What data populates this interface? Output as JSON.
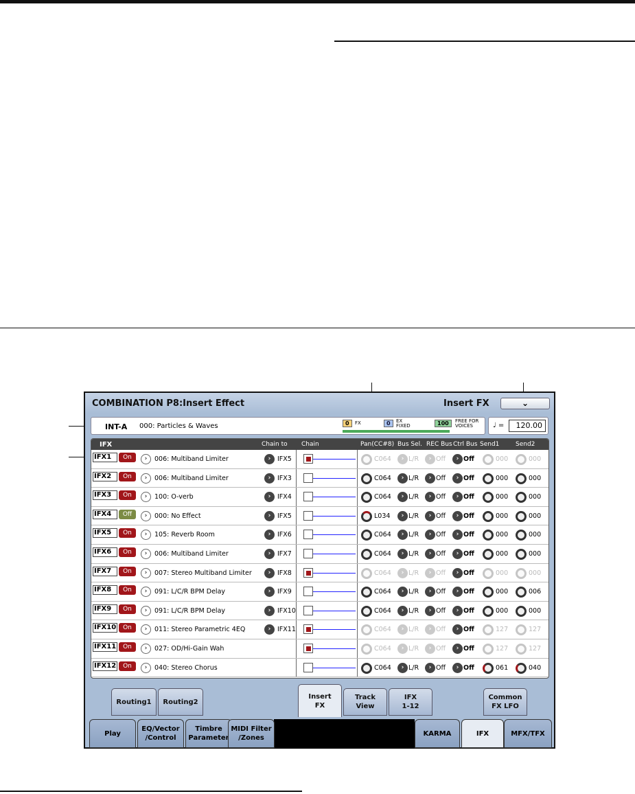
{
  "header": {
    "title": "COMBINATION P8:Insert Effect",
    "page": "Insert FX",
    "menu_icon": "chevron-down-icon"
  },
  "info": {
    "bank": "INT-A",
    "program": "000: Particles & Waves",
    "fx": "0",
    "fx_label": "FX",
    "ex": "0",
    "ex_label1": "EX",
    "ex_label2": "FIXED",
    "free": "100",
    "free_label1": "FREE FOR",
    "free_label2": "VOICES",
    "tempo_symbol": "♩ =",
    "tempo": "120.00"
  },
  "columns": {
    "ifx": "IFX",
    "chain_to": "Chain to",
    "chain": "Chain",
    "pan": "Pan(CC#8)",
    "bus": "Bus Sel.",
    "rec": "REC Bus",
    "ctrl": "Ctrl Bus",
    "send1": "Send1",
    "send2": "Send2"
  },
  "rows": [
    {
      "ifx": "IFX1",
      "state": "On",
      "fx": "006: Multiband Limiter",
      "chain_to": "IFX5",
      "chain": true,
      "pan": "C064",
      "bus": "L/R",
      "rec": "Off",
      "ctrl": "Off",
      "send1": "000",
      "send2": "000",
      "dim": true
    },
    {
      "ifx": "IFX2",
      "state": "On",
      "fx": "006: Multiband Limiter",
      "chain_to": "IFX3",
      "chain": false,
      "pan": "C064",
      "bus": "L/R",
      "rec": "Off",
      "ctrl": "Off",
      "send1": "000",
      "send2": "000",
      "dim": false
    },
    {
      "ifx": "IFX3",
      "state": "On",
      "fx": "100: O-verb",
      "chain_to": "IFX4",
      "chain": false,
      "pan": "C064",
      "bus": "L/R",
      "rec": "Off",
      "ctrl": "Off",
      "send1": "000",
      "send2": "000",
      "dim": false
    },
    {
      "ifx": "IFX4",
      "state": "Off",
      "fx": "000: No Effect",
      "chain_to": "IFX5",
      "chain": false,
      "pan": "L034",
      "bus": "L/R",
      "rec": "Off",
      "ctrl": "Off",
      "send1": "000",
      "send2": "000",
      "dim": false
    },
    {
      "ifx": "IFX5",
      "state": "On",
      "fx": "105: Reverb Room",
      "chain_to": "IFX6",
      "chain": false,
      "pan": "C064",
      "bus": "L/R",
      "rec": "Off",
      "ctrl": "Off",
      "send1": "000",
      "send2": "000",
      "dim": false
    },
    {
      "ifx": "IFX6",
      "state": "On",
      "fx": "006: Multiband Limiter",
      "chain_to": "IFX7",
      "chain": false,
      "pan": "C064",
      "bus": "L/R",
      "rec": "Off",
      "ctrl": "Off",
      "send1": "000",
      "send2": "000",
      "dim": false
    },
    {
      "ifx": "IFX7",
      "state": "On",
      "fx": "007: Stereo Multiband Limiter",
      "chain_to": "IFX8",
      "chain": true,
      "pan": "C064",
      "bus": "L/R",
      "rec": "Off",
      "ctrl": "Off",
      "send1": "000",
      "send2": "000",
      "dim": true
    },
    {
      "ifx": "IFX8",
      "state": "On",
      "fx": "091: L/C/R BPM Delay",
      "chain_to": "IFX9",
      "chain": false,
      "pan": "C064",
      "bus": "L/R",
      "rec": "Off",
      "ctrl": "Off",
      "send1": "000",
      "send2": "006",
      "dim": false
    },
    {
      "ifx": "IFX9",
      "state": "On",
      "fx": "091: L/C/R BPM Delay",
      "chain_to": "IFX10",
      "chain": false,
      "pan": "C064",
      "bus": "L/R",
      "rec": "Off",
      "ctrl": "Off",
      "send1": "000",
      "send2": "000",
      "dim": false
    },
    {
      "ifx": "IFX10",
      "state": "On",
      "fx": "011: Stereo Parametric 4EQ",
      "chain_to": "IFX11",
      "chain": true,
      "pan": "C064",
      "bus": "L/R",
      "rec": "Off",
      "ctrl": "Off",
      "send1": "127",
      "send2": "127",
      "dim": true
    },
    {
      "ifx": "IFX11",
      "state": "On",
      "fx": "027: OD/Hi-Gain Wah",
      "chain_to": "",
      "chain": true,
      "pan": "C064",
      "bus": "L/R",
      "rec": "Off",
      "ctrl": "Off",
      "send1": "127",
      "send2": "127",
      "dim": true
    },
    {
      "ifx": "IFX12",
      "state": "On",
      "fx": "040: Stereo Chorus",
      "chain_to": "",
      "chain": false,
      "pan": "C064",
      "bus": "L/R",
      "rec": "Off",
      "ctrl": "Off",
      "send1": "061",
      "send2": "040",
      "dim": false
    }
  ],
  "page_tabs": [
    "Routing1",
    "Routing2",
    "Insert\nFX",
    "Track\nView",
    "IFX\n1-12",
    "Common\nFX LFO"
  ],
  "mode_tabs": [
    "Play",
    "EQ/Vector\n/Control",
    "Timbre\nParameter",
    "MIDI Filter\n/Zones",
    "KARMA",
    "IFX",
    "MFX/TFX"
  ],
  "colors": {
    "on": "#a1161a",
    "off": "#7c8b44",
    "chain_line": "#2222ff",
    "screen_bg": "#a9bdd6"
  }
}
